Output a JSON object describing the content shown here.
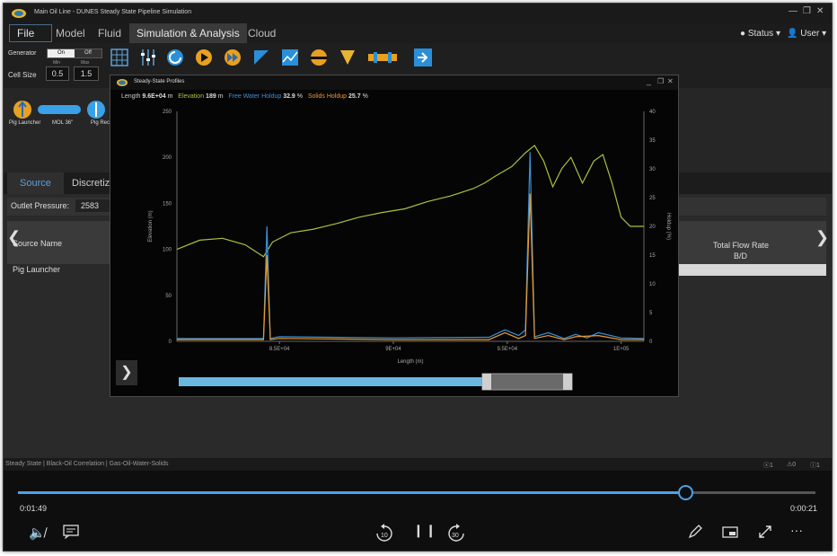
{
  "window": {
    "title": "Main Oil Line - DUNES Steady State Pipeline Simulation",
    "min": "—",
    "restore": "❐",
    "close": "✕"
  },
  "menu": {
    "file": "File",
    "items": [
      "Model",
      "Fluid",
      "Simulation & Analysis",
      "Cloud"
    ]
  },
  "right_menu": {
    "status": "Status",
    "user": "User"
  },
  "toolbar": {
    "generator_label": "Generator",
    "on": "On",
    "off": "Off",
    "min": "Min",
    "max": "Max",
    "cell_size_label": "Cell Size",
    "cell_min": "0.5",
    "cell_max": "1.5"
  },
  "components": [
    {
      "label": "Pig Launcher"
    },
    {
      "label": "MOL 36\""
    },
    {
      "label": "Pig Rece"
    }
  ],
  "tabs": [
    "Source",
    "Discretiz"
  ],
  "outlet": {
    "label": "Outlet Pressure:",
    "value": "2583"
  },
  "table": {
    "header_left": "Source Name",
    "header_right_1": "Total Flow Rate",
    "header_right_2": "B/D",
    "row": "Pig Launcher"
  },
  "chart_window": {
    "title": "Steady-State Profiles",
    "legend": {
      "length_label": "Length",
      "length_value": "9.6E+04",
      "length_unit": "m",
      "elev_label": "Elevation",
      "elev_value": "189",
      "elev_unit": "m",
      "fwh_label": "Free Water Holdup",
      "fwh_value": "32.9",
      "fwh_unit": "%",
      "sh_label": "Solids Holdup",
      "sh_value": "25.7",
      "sh_unit": "%"
    },
    "colors": {
      "elevation": "#a8c23a",
      "water": "#3a8fd8",
      "solids": "#e89a2a"
    }
  },
  "chart_data": {
    "type": "line",
    "xlabel": "Length (m)",
    "ylabel": "Elevation (m)",
    "y2label": "Holdup (%)",
    "xlim": [
      80500,
      101000
    ],
    "ylim": [
      0,
      250
    ],
    "y2lim": [
      0,
      40
    ],
    "xticks": [
      "8.5E+04",
      "9E+04",
      "9.5E+04",
      "1E+05"
    ],
    "xtick_values": [
      85000,
      90000,
      95000,
      100000
    ],
    "yticks": [
      "0",
      "50",
      "100",
      "150",
      "200",
      "250"
    ],
    "y2ticks": [
      "0",
      "5",
      "10",
      "15",
      "20",
      "25",
      "30",
      "35",
      "40"
    ],
    "series": [
      {
        "key": "elevation",
        "axis": "left",
        "x": [
          80500,
          81500,
          82500,
          83500,
          84300,
          84700,
          85500,
          86500,
          87500,
          88500,
          89500,
          90500,
          91500,
          92500,
          93500,
          94000,
          94500,
          95200,
          95800,
          96200,
          96600,
          97000,
          97400,
          97800,
          98300,
          98800,
          99200,
          99600,
          100000,
          100400,
          101000
        ],
        "y": [
          100,
          110,
          112,
          105,
          92,
          108,
          118,
          122,
          128,
          135,
          140,
          144,
          152,
          158,
          166,
          172,
          180,
          190,
          205,
          213,
          196,
          168,
          188,
          200,
          172,
          196,
          203,
          172,
          135,
          125,
          125
        ]
      },
      {
        "key": "water",
        "axis": "right",
        "x": [
          80500,
          84300,
          84450,
          84600,
          85000,
          90000,
          94200,
          94900,
          95500,
          95800,
          96000,
          96200,
          96800,
          97500,
          98000,
          98500,
          99000,
          100000,
          101000
        ],
        "y": [
          0.5,
          0.5,
          20,
          0.5,
          0.8,
          0.6,
          0.7,
          2,
          1,
          2,
          32.9,
          0.8,
          1.5,
          0.5,
          1.2,
          0.6,
          1.5,
          0.6,
          0.5
        ]
      },
      {
        "key": "solids",
        "axis": "right",
        "x": [
          80500,
          84300,
          84450,
          84600,
          85000,
          90000,
          94200,
          94900,
          95500,
          95800,
          96000,
          96200,
          96800,
          97500,
          98000,
          99000,
          100000,
          101000
        ],
        "y": [
          0.3,
          0.3,
          15,
          0.3,
          0.5,
          0.3,
          0.3,
          1.5,
          0.5,
          1,
          25.7,
          0.5,
          1,
          0.3,
          0.8,
          1,
          0.3,
          0.3
        ]
      }
    ]
  },
  "statusbar": {
    "left": "Steady State | Black-Oil Correlation | Gas-Oil-Water-Solids",
    "c1": "1",
    "c2": "0",
    "c3": "1"
  },
  "video": {
    "elapsed": "0:01:49",
    "remaining": "0:00:21",
    "skip_back": "10",
    "skip_fwd": "30",
    "progress": 0.836
  }
}
